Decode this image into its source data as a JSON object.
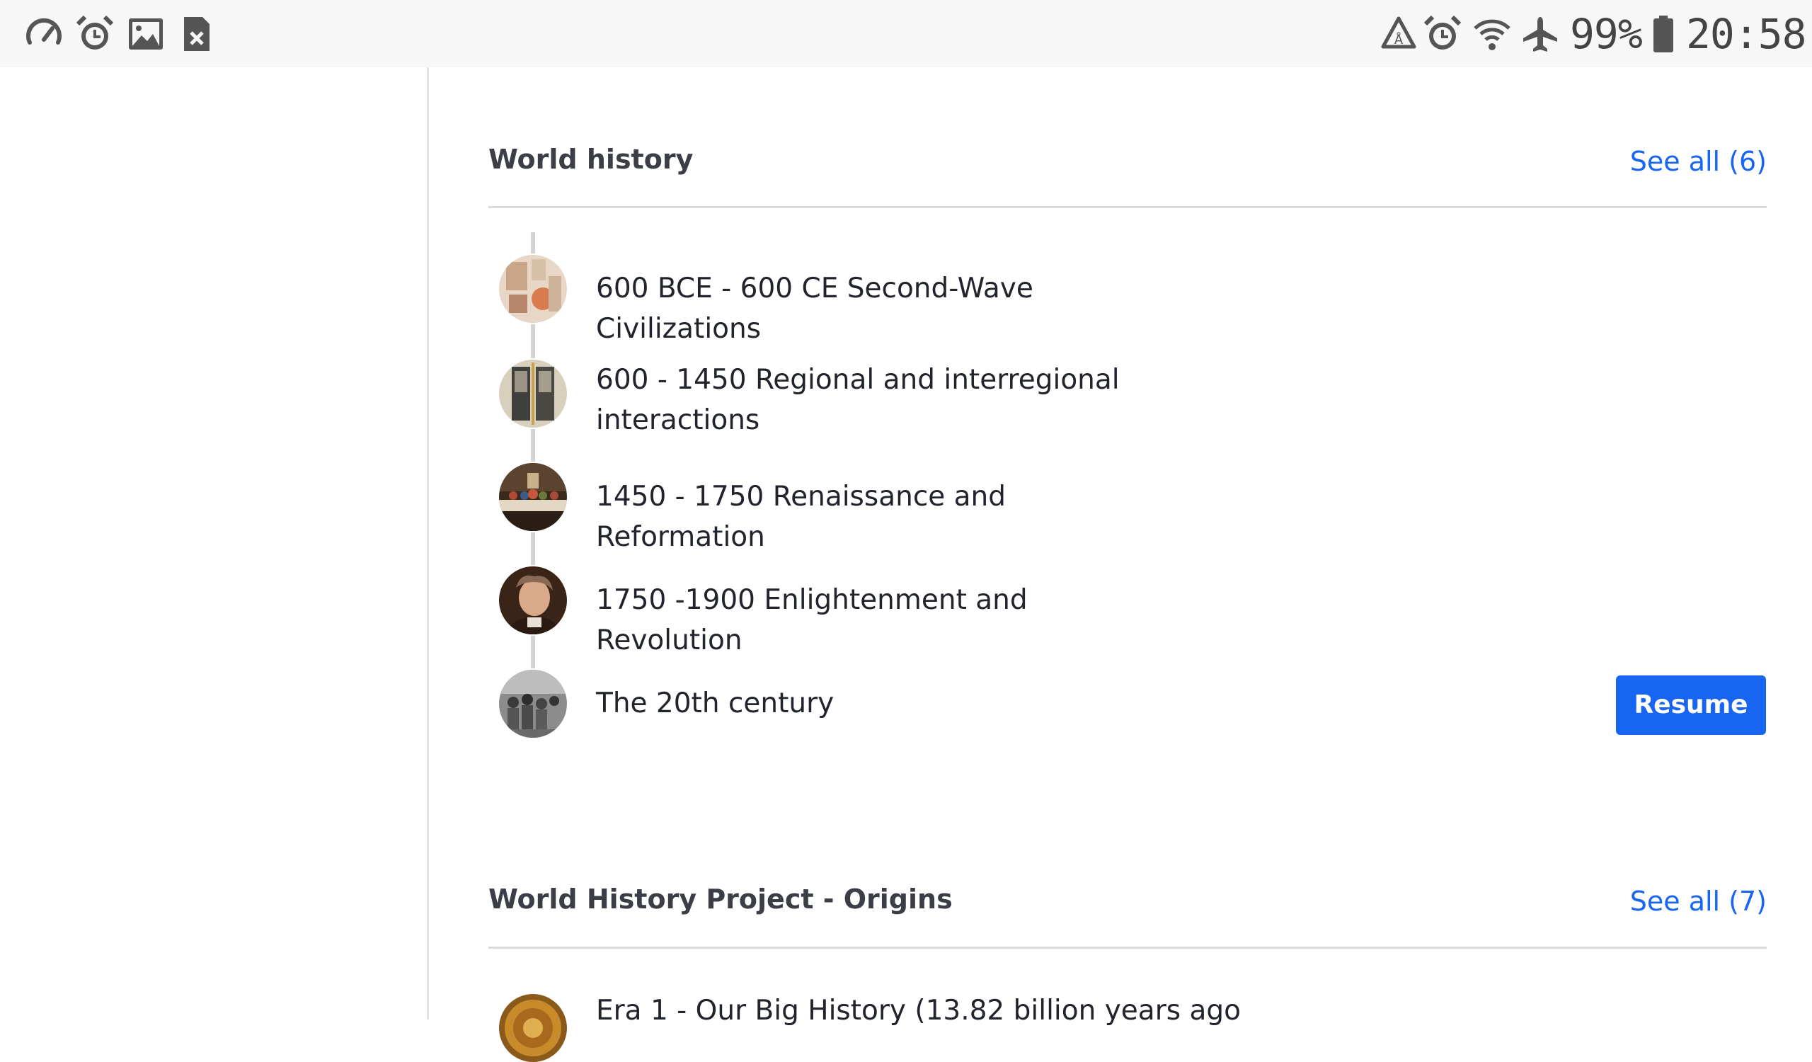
{
  "status_bar": {
    "left_icons": [
      "speedometer-icon",
      "alarm-icon",
      "image-icon",
      "file-x-icon"
    ],
    "right_icons": [
      "recycle-icon",
      "alarm-icon",
      "wifi-icon",
      "airplane-icon",
      "battery-icon"
    ],
    "battery": "99%",
    "time": "20:58"
  },
  "sections": [
    {
      "title": "World history",
      "see_all": "See all (6)",
      "topics": [
        {
          "label": "600 BCE - 600 CE Second-Wave Civilizations"
        },
        {
          "label": "600 - 1450 Regional and interregional interactions"
        },
        {
          "label": "1450 - 1750 Renaissance and Reformation"
        },
        {
          "label": "1750 -1900 Enlightenment and Revolution"
        },
        {
          "label": "The 20th century",
          "action": "Resume"
        }
      ]
    },
    {
      "title": "World History Project - Origins",
      "see_all": "See all (7)",
      "topics": [
        {
          "label": "Era 1 - Our Big History (13.82 billion years ago"
        }
      ]
    }
  ],
  "colors": {
    "accent": "#1865f2",
    "status_bar_bg": "#f7f7f7",
    "text": "#21242c"
  }
}
